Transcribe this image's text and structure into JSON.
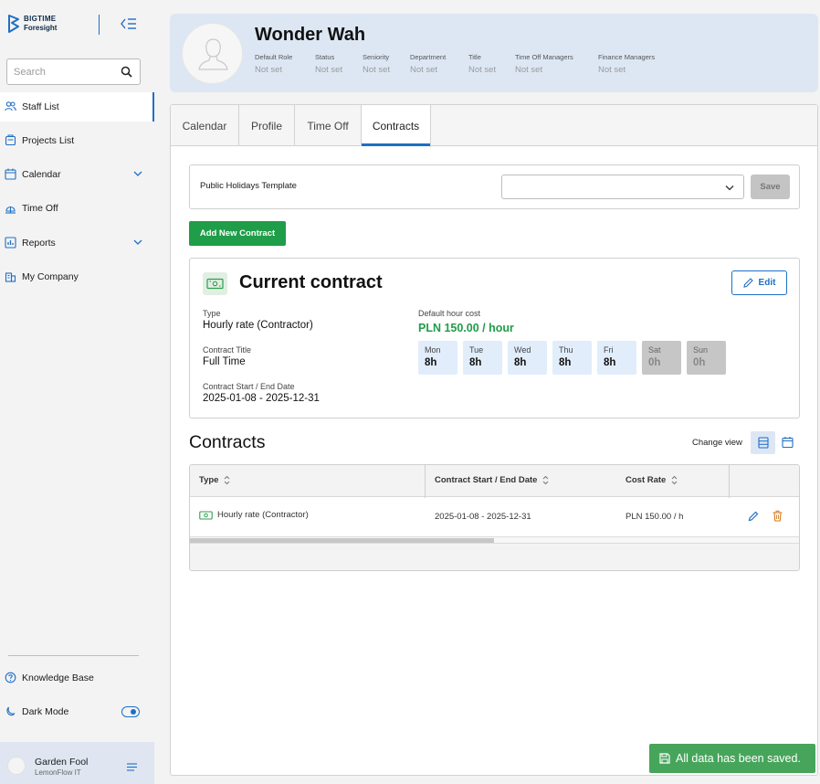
{
  "brand": {
    "line1": "BIGTIME",
    "line2": "Foresight"
  },
  "search": {
    "placeholder": "Search"
  },
  "nav": {
    "items": [
      {
        "label": "Staff List",
        "icon": "users-icon"
      },
      {
        "label": "Projects List",
        "icon": "projects-icon"
      },
      {
        "label": "Calendar",
        "icon": "calendar-icon"
      },
      {
        "label": "Time Off",
        "icon": "time-off-icon"
      },
      {
        "label": "Reports",
        "icon": "reports-icon"
      },
      {
        "label": "My Company",
        "icon": "company-icon"
      }
    ],
    "knowledge_base": "Knowledge Base",
    "dark_mode": "Dark Mode"
  },
  "user": {
    "name": "Garden Fool",
    "org": "LemonFlow IT"
  },
  "profile": {
    "name": "Wonder Wah",
    "fields": [
      {
        "label": "Default Role",
        "value": "Not set"
      },
      {
        "label": "Status",
        "value": "Not set"
      },
      {
        "label": "Seniority",
        "value": "Not set"
      },
      {
        "label": "Department",
        "value": "Not set"
      },
      {
        "label": "Title",
        "value": "Not set"
      },
      {
        "label": "Time Off Managers",
        "value": "Not set"
      },
      {
        "label": "Finance Managers",
        "value": "Not set"
      }
    ]
  },
  "tabs": [
    "Calendar",
    "Profile",
    "Time Off",
    "Contracts"
  ],
  "holidays": {
    "label": "Public Holidays Template",
    "selected": "",
    "save_label": "Save"
  },
  "add_contract_label": "Add New Contract",
  "current_contract": {
    "title": "Current contract",
    "edit_label": "Edit",
    "type_label": "Type",
    "type_value": "Hourly rate (Contractor)",
    "contract_title_label": "Contract Title",
    "contract_title_value": "Full Time",
    "dates_label": "Contract Start / End Date",
    "dates_value": "2025-01-08 - 2025-12-31",
    "cost_label": "Default hour cost",
    "cost_value": "PLN 150.00 / hour",
    "days": [
      {
        "name": "Mon",
        "hours": "8h",
        "off": false
      },
      {
        "name": "Tue",
        "hours": "8h",
        "off": false
      },
      {
        "name": "Wed",
        "hours": "8h",
        "off": false
      },
      {
        "name": "Thu",
        "hours": "8h",
        "off": false
      },
      {
        "name": "Fri",
        "hours": "8h",
        "off": false
      },
      {
        "name": "Sat",
        "hours": "0h",
        "off": true
      },
      {
        "name": "Sun",
        "hours": "0h",
        "off": true
      }
    ]
  },
  "contracts": {
    "title": "Contracts",
    "change_view_label": "Change view",
    "columns": [
      "Type",
      "Contract Start / End Date",
      "Cost Rate"
    ],
    "rows": [
      {
        "type": "Hourly rate (Contractor)",
        "dates": "2025-01-08 - 2025-12-31",
        "cost_rate": "PLN 150.00 / h"
      }
    ]
  },
  "toast": {
    "message": "All data has been saved."
  },
  "colors": {
    "accent": "#1f6fc4",
    "success": "#1f9d49",
    "toast": "#46a55b",
    "header_bg": "#dde7f4"
  }
}
